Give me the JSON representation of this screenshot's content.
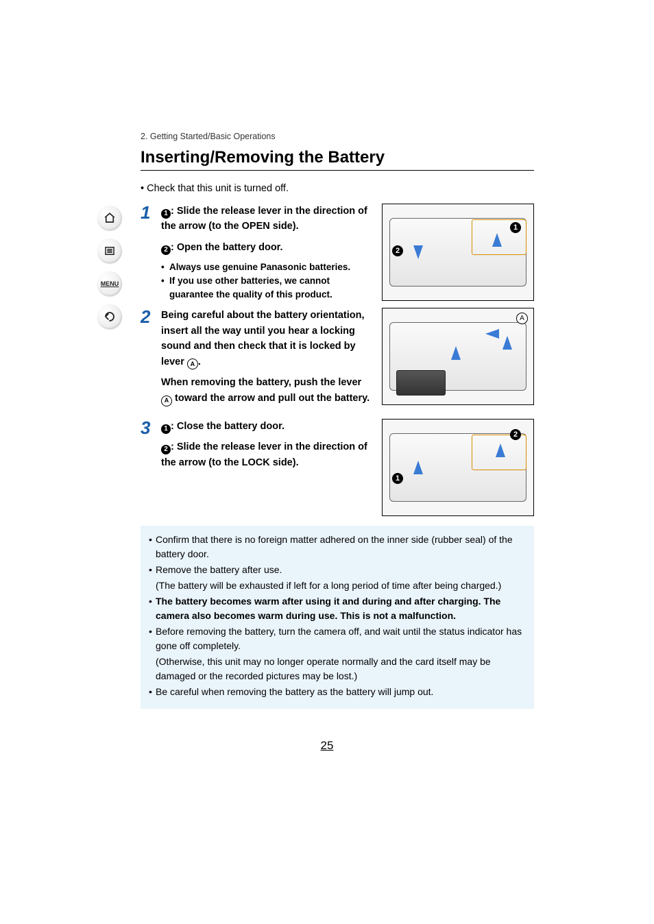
{
  "sidebar": {
    "home_label": "",
    "list_label": "",
    "menu_label": "MENU",
    "back_label": ""
  },
  "crumb": "2. Getting Started/Basic Operations",
  "title": "Inserting/Removing the Battery",
  "pre_note": "• Check that this unit is turned off.",
  "steps": {
    "s1": {
      "num": "1",
      "line1a": ": Slide the release lever in the direction of the arrow (to the OPEN side).",
      "line2a": ": Open the battery door.",
      "sub1": "Always use genuine Panasonic batteries.",
      "sub2": "If you use other batteries, we cannot guarantee the quality of this product."
    },
    "s2": {
      "num": "2",
      "line1": "Being careful about the battery orientation, insert all the way until you hear a locking sound and then check that it is locked by lever ",
      "line1tail": ".",
      "line2a": "When removing the battery, push the lever ",
      "line2b": " toward the arrow and pull out the battery."
    },
    "s3": {
      "num": "3",
      "line1a": ": Close the battery door.",
      "line2a": ": Slide the release lever in the direction of the arrow (to the LOCK side)."
    }
  },
  "notes": {
    "n1": "Confirm that there is no foreign matter adhered on the inner side (rubber seal) of the battery door.",
    "n2a": "Remove the battery after use.",
    "n2b": "(The battery will be exhausted if left for a long period of time after being charged.)",
    "n3": "The battery becomes warm after using it and during and after charging. The camera also becomes warm during use. This is not a malfunction.",
    "n4a": "Before removing the battery, turn the camera off, and wait until the status indicator has gone off completely.",
    "n4b": "(Otherwise, this unit may no longer operate normally and the card itself may be damaged or the recorded pictures may be lost.)",
    "n5": "Be careful when removing the battery as the battery will jump out."
  },
  "page_number": "25",
  "badges": {
    "one": "1",
    "two": "2",
    "A": "A"
  }
}
